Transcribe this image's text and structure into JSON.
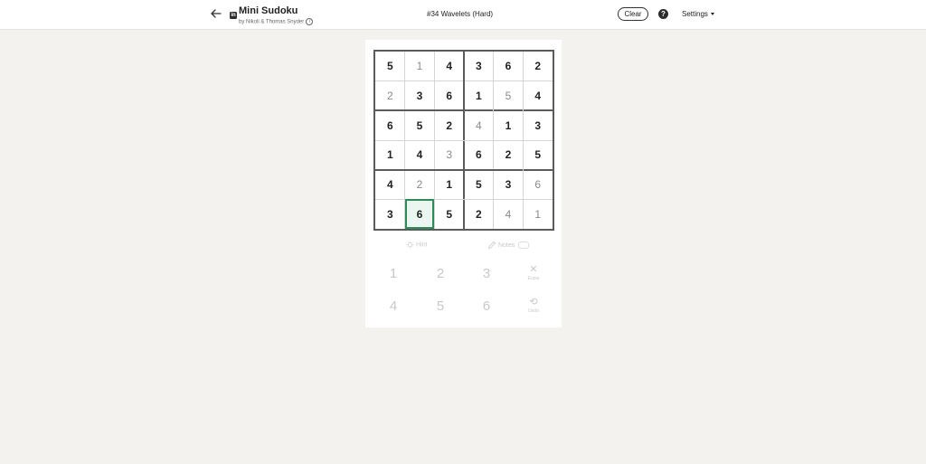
{
  "header": {
    "app_title": "Mini Sudoku",
    "byline": "by Nikoli & Thomas Snyder",
    "puzzle_title": "#34 Wavelets (Hard)",
    "clear_label": "Clear",
    "help_label": "?",
    "settings_label": "Settings"
  },
  "board": {
    "size": 6,
    "selected": [
      5,
      1
    ],
    "rows": [
      [
        {
          "v": "5",
          "t": "given"
        },
        {
          "v": "1",
          "t": "entered"
        },
        {
          "v": "4",
          "t": "given"
        },
        {
          "v": "3",
          "t": "given"
        },
        {
          "v": "6",
          "t": "given"
        },
        {
          "v": "2",
          "t": "given"
        }
      ],
      [
        {
          "v": "2",
          "t": "entered"
        },
        {
          "v": "3",
          "t": "given"
        },
        {
          "v": "6",
          "t": "given"
        },
        {
          "v": "1",
          "t": "given"
        },
        {
          "v": "5",
          "t": "entered"
        },
        {
          "v": "4",
          "t": "given"
        }
      ],
      [
        {
          "v": "6",
          "t": "given"
        },
        {
          "v": "5",
          "t": "given"
        },
        {
          "v": "2",
          "t": "given"
        },
        {
          "v": "4",
          "t": "entered"
        },
        {
          "v": "1",
          "t": "given"
        },
        {
          "v": "3",
          "t": "given"
        }
      ],
      [
        {
          "v": "1",
          "t": "given"
        },
        {
          "v": "4",
          "t": "given"
        },
        {
          "v": "3",
          "t": "entered"
        },
        {
          "v": "6",
          "t": "given"
        },
        {
          "v": "2",
          "t": "given"
        },
        {
          "v": "5",
          "t": "given"
        }
      ],
      [
        {
          "v": "4",
          "t": "given"
        },
        {
          "v": "2",
          "t": "entered"
        },
        {
          "v": "1",
          "t": "given"
        },
        {
          "v": "5",
          "t": "given"
        },
        {
          "v": "3",
          "t": "given"
        },
        {
          "v": "6",
          "t": "entered"
        }
      ],
      [
        {
          "v": "3",
          "t": "given"
        },
        {
          "v": "6",
          "t": "given"
        },
        {
          "v": "5",
          "t": "given"
        },
        {
          "v": "2",
          "t": "given"
        },
        {
          "v": "4",
          "t": "entered"
        },
        {
          "v": "1",
          "t": "entered"
        }
      ]
    ]
  },
  "tools": {
    "hint_label": "Hint",
    "notes_label": "Notes"
  },
  "keypad": {
    "keys": [
      "1",
      "2",
      "3",
      "4",
      "5",
      "6"
    ],
    "erase_label": "Erase",
    "undo_label": "Undo"
  },
  "colors": {
    "background": "#f3f2ef",
    "selected_border": "#2d8c5a",
    "selected_fill": "#eaf6ef",
    "disabled_text": "#c8c8c8"
  }
}
